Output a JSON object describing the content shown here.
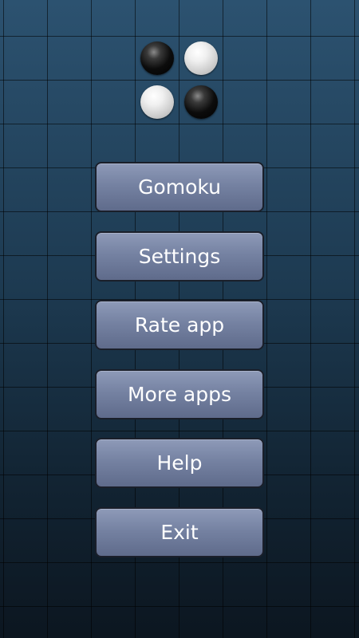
{
  "logo": {
    "stones": [
      "black",
      "white",
      "white",
      "black"
    ]
  },
  "menu": {
    "items": [
      {
        "label": "Gomoku"
      },
      {
        "label": "Settings"
      },
      {
        "label": "Rate app"
      },
      {
        "label": "More apps"
      },
      {
        "label": "Help"
      },
      {
        "label": "Exit"
      }
    ]
  },
  "colors": {
    "background_top": "#2c5270",
    "background_bottom": "#0c1620",
    "grid_lines": "#000000",
    "button_top": "#8e9ab8",
    "button_bottom": "#5f6b8b",
    "button_text": "#ffffff"
  }
}
